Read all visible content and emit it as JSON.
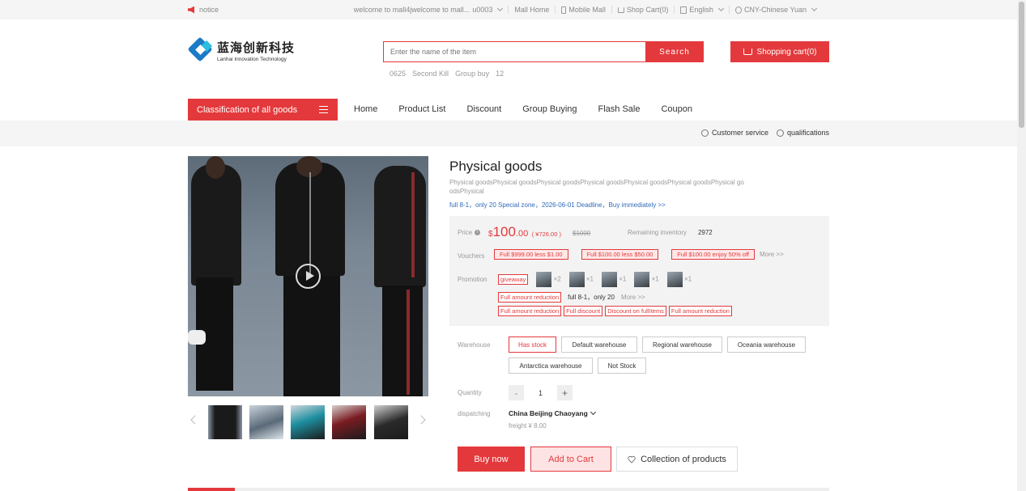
{
  "topbar": {
    "notice": "notice",
    "welcome": "welcome to mall4jwelcome to mall...",
    "user": "u0003",
    "mall_home": "Mall Home",
    "mobile_mall": "Mobile Mall",
    "shop_cart": "Shop Cart(0)",
    "language": "English",
    "currency": "CNY-Chinese Yuan"
  },
  "header": {
    "logo_cn": "蓝海创新科技",
    "logo_en": "Lanhai Innovation Technology",
    "search_placeholder": "Enter the name of the item",
    "search_button": "Search",
    "hot_words": [
      "0625",
      "Second Kill",
      "Group buy",
      "12"
    ],
    "cart_button": "Shopping cart(0)"
  },
  "nav": {
    "category_button": "Classification of all goods",
    "items": [
      "Home",
      "Product List",
      "Discount",
      "Group Buying",
      "Flash Sale",
      "Coupon"
    ],
    "customer_service": "Customer service",
    "qualifications": "qualifications"
  },
  "product": {
    "title": "Physical goods",
    "subtitle": "Physical goodsPhysical goodsPhysical goodsPhysical goodsPhysical goodsPhysical goodsPhysical goodsPhysical",
    "promo_link": "full 8-1，only 20 Special zone，2026-06-01 Deadline，Buy immediately >>",
    "price_label": "Price",
    "currency_symbol": "$",
    "price_int": "100",
    "price_dec": ".00",
    "price_cny": "( ¥726.00 )",
    "original_price": "$1000",
    "inventory_label": "Remaining inventory",
    "inventory": "2972",
    "vouchers_label": "Vouchers",
    "vouchers": [
      "Full $999.00 less $1.00",
      "Full $100.00 less $50.00",
      "Full $100.00 enjoy 50% off"
    ],
    "more": "More >>",
    "promotion_label": "Promotion",
    "giveaway": "giveaway",
    "gifts": [
      "×2",
      "×1",
      "×1",
      "×1",
      "×1"
    ],
    "full_reduction": "Full amount reduction",
    "full_reduction_text": "full 8-1，only 20",
    "promo_tags": [
      "Full amount reduction",
      "Full discount",
      "Discount on fullItems",
      "Full amount reduction"
    ],
    "warehouse_label": "Warehouse",
    "warehouses": [
      "Has stock",
      "Default warehouse",
      "Regional warehouse",
      "Oceania warehouse",
      "Antarctica warehouse",
      "Not Stock"
    ],
    "quantity_label": "Quantity",
    "quantity": "1",
    "minus": "-",
    "plus": "+",
    "dispatch_label": "dispatching",
    "dispatch_location": "China Beijing Chaoyang",
    "freight": "freight ¥ 8.00",
    "buy_now": "Buy now",
    "add_to_cart": "Add to Cart",
    "collection": "Collection of products"
  },
  "colors": {
    "accent": "#e4393c",
    "link": "#2f6bba",
    "logo_blue": "#1a7bc6"
  }
}
